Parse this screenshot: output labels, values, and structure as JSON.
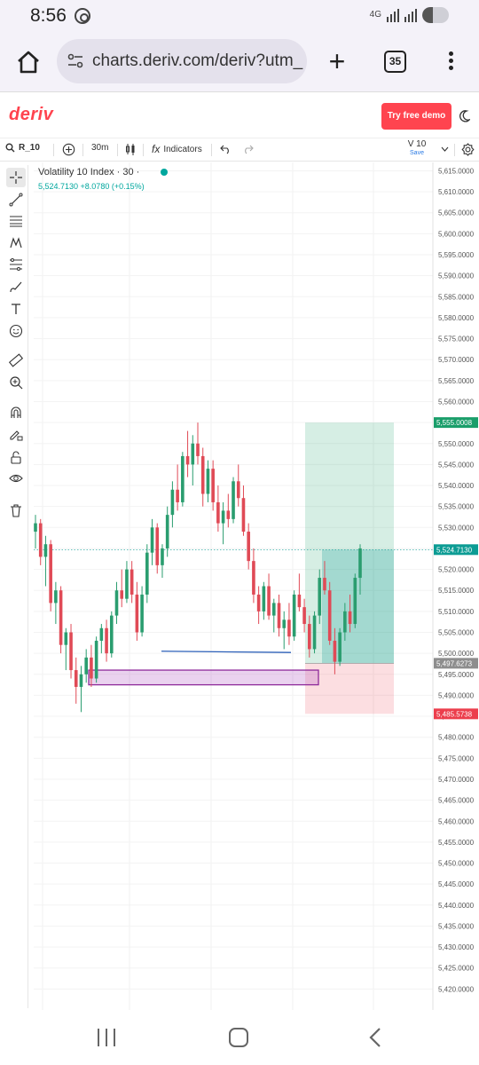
{
  "status": {
    "time": "8:56",
    "network": "4G"
  },
  "browser": {
    "url": "charts.deriv.com/deriv?utm_ad",
    "tab_count": "35"
  },
  "header": {
    "logo": "deriv",
    "demo_button": "Try free demo"
  },
  "toolbar": {
    "symbol": "R_10",
    "interval": "30m",
    "indicators": "Indicators",
    "version": "V 10",
    "save": "Save"
  },
  "chart": {
    "title": "Volatility 10 Index · 30 ·",
    "quote": "5,524.7130  +8.0780 (+0.15%)"
  },
  "chart_data": {
    "type": "candlestick",
    "y_ticks": [
      "5,615.0000",
      "5,610.0000",
      "5,605.0000",
      "5,600.0000",
      "5,595.0000",
      "5,590.0000",
      "5,585.0000",
      "5,580.0000",
      "5,575.0000",
      "5,570.0000",
      "5,565.0000",
      "5,560.0000",
      "5,555.0000",
      "5,550.0000",
      "5,545.0000",
      "5,540.0000",
      "5,535.0000",
      "5,530.0000",
      "5,525.0000",
      "5,520.0000",
      "5,515.0000",
      "5,510.0000",
      "5,505.0000",
      "5,500.0000",
      "5,495.0000",
      "5,490.0000",
      "5,485.0000",
      "5,480.0000",
      "5,475.0000",
      "5,470.0000",
      "5,465.0000",
      "5,460.0000",
      "5,455.0000",
      "5,450.0000",
      "5,445.0000",
      "5,440.0000",
      "5,435.0000",
      "5,430.0000",
      "5,425.0000",
      "5,420.0000"
    ],
    "ylim": [
      5415,
      5617
    ],
    "price_tags": [
      {
        "label": "5,555.0008",
        "value": 5555.0008,
        "color": "#1a9e6a"
      },
      {
        "label": "5,524.7130",
        "value": 5524.713,
        "color": "#0c9c94"
      },
      {
        "label": "5,497.6273",
        "value": 5497.6273,
        "color": "#8d8d8d"
      },
      {
        "label": "5,485.5738",
        "value": 5485.5738,
        "color": "#ec3e4c"
      }
    ],
    "current_price": 5524.713,
    "position": {
      "entry": 5497.6273,
      "target": 5555.0008,
      "stop": 5485.5738
    },
    "candles": [
      [
        5529,
        5533,
        5525,
        5531
      ],
      [
        5531,
        5532,
        5521,
        5523
      ],
      [
        5523,
        5528,
        5516,
        5526
      ],
      [
        5526,
        5527,
        5510,
        5512
      ],
      [
        5512,
        5517,
        5507,
        5515
      ],
      [
        5515,
        5516,
        5500,
        5502
      ],
      [
        5502,
        5506,
        5496,
        5505
      ],
      [
        5505,
        5507,
        5494,
        5496
      ],
      [
        5496,
        5499,
        5488,
        5492
      ],
      [
        5492,
        5497,
        5486,
        5495
      ],
      [
        5495,
        5501,
        5493,
        5499
      ],
      [
        5499,
        5502,
        5492,
        5494
      ],
      [
        5494,
        5504,
        5493,
        5503
      ],
      [
        5503,
        5507,
        5500,
        5506
      ],
      [
        5506,
        5508,
        5498,
        5500
      ],
      [
        5500,
        5510,
        5499,
        5509
      ],
      [
        5509,
        5517,
        5507,
        5515
      ],
      [
        5515,
        5520,
        5511,
        5513
      ],
      [
        5513,
        5522,
        5512,
        5520
      ],
      [
        5520,
        5522,
        5512,
        5514
      ],
      [
        5514,
        5517,
        5503,
        5505
      ],
      [
        5505,
        5516,
        5504,
        5514
      ],
      [
        5514,
        5526,
        5512,
        5524
      ],
      [
        5524,
        5532,
        5521,
        5530
      ],
      [
        5530,
        5531,
        5519,
        5521
      ],
      [
        5521,
        5526,
        5518,
        5525
      ],
      [
        5525,
        5535,
        5523,
        5533
      ],
      [
        5533,
        5541,
        5530,
        5539
      ],
      [
        5539,
        5545,
        5534,
        5536
      ],
      [
        5536,
        5548,
        5535,
        5547
      ],
      [
        5547,
        5553,
        5542,
        5545
      ],
      [
        5545,
        5552,
        5540,
        5550
      ],
      [
        5550,
        5555,
        5545,
        5547
      ],
      [
        5547,
        5549,
        5535,
        5538
      ],
      [
        5538,
        5546,
        5536,
        5544
      ],
      [
        5544,
        5546,
        5534,
        5536
      ],
      [
        5536,
        5540,
        5529,
        5531
      ],
      [
        5531,
        5536,
        5526,
        5534
      ],
      [
        5534,
        5538,
        5530,
        5532
      ],
      [
        5532,
        5542,
        5531,
        5541
      ],
      [
        5541,
        5545,
        5535,
        5537
      ],
      [
        5537,
        5540,
        5528,
        5529
      ],
      [
        5529,
        5531,
        5520,
        5522
      ],
      [
        5522,
        5525,
        5512,
        5514
      ],
      [
        5514,
        5516,
        5507,
        5510
      ],
      [
        5510,
        5517,
        5508,
        5516
      ],
      [
        5516,
        5519,
        5508,
        5509
      ],
      [
        5509,
        5513,
        5505,
        5512
      ],
      [
        5512,
        5514,
        5504,
        5506
      ],
      [
        5506,
        5510,
        5501,
        5508
      ],
      [
        5508,
        5512,
        5502,
        5504
      ],
      [
        5504,
        5515,
        5503,
        5514
      ],
      [
        5514,
        5519,
        5510,
        5511
      ],
      [
        5511,
        5513,
        5505,
        5507
      ],
      [
        5507,
        5509,
        5499,
        5501
      ],
      [
        5501,
        5510,
        5500,
        5509
      ],
      [
        5509,
        5520,
        5507,
        5518
      ],
      [
        5518,
        5522,
        5514,
        5515
      ],
      [
        5515,
        5517,
        5502,
        5503
      ],
      [
        5503,
        5506,
        5495,
        5498
      ],
      [
        5498,
        5506,
        5497,
        5505
      ],
      [
        5505,
        5512,
        5503,
        5510
      ],
      [
        5510,
        5514,
        5505,
        5507
      ],
      [
        5507,
        5519,
        5506,
        5518
      ],
      [
        5518,
        5526,
        5514,
        5525
      ]
    ]
  }
}
